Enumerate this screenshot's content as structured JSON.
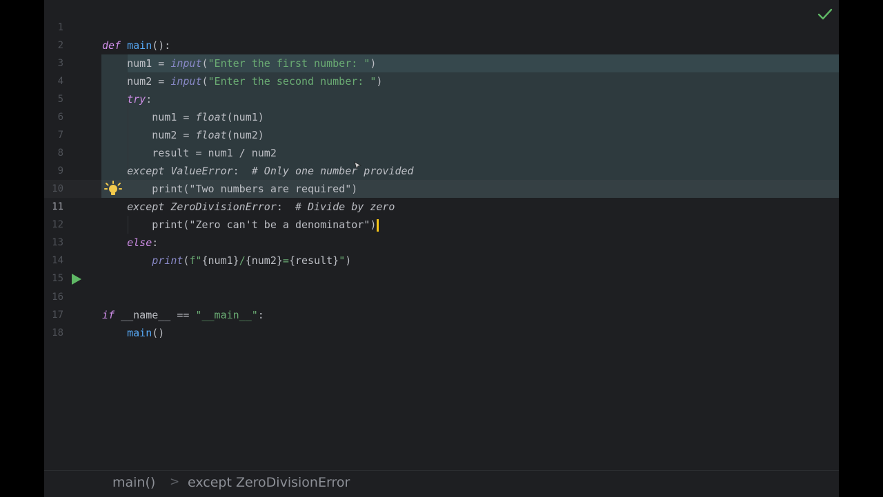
{
  "editor": {
    "language": "python",
    "current_line": 11,
    "lines": [
      {
        "n": "1",
        "text": "def main():"
      },
      {
        "n": "2",
        "text": "    num1 = input(\"Enter the first number: \")"
      },
      {
        "n": "3",
        "text": "    num2 = input(\"Enter the second number: \")"
      },
      {
        "n": "4",
        "text": "    try:"
      },
      {
        "n": "5",
        "text": "        num1 = float(num1)"
      },
      {
        "n": "6",
        "text": "        num2 = float(num2)"
      },
      {
        "n": "7",
        "text": "        result = num1 / num2"
      },
      {
        "n": "8",
        "text": "    except ValueError:  # Only one number provided"
      },
      {
        "n": "9",
        "text": "        print(\"Two numbers are required\")"
      },
      {
        "n": "10",
        "text": "    except ZeroDivisionError:  # Divide by zero"
      },
      {
        "n": "11",
        "text": "        print(\"Zero can't be a denominator\")"
      },
      {
        "n": "12",
        "text": "    else:"
      },
      {
        "n": "13",
        "text": "        print(f\"{num1}/{num2}={result}\")"
      },
      {
        "n": "14",
        "text": ""
      },
      {
        "n": "15",
        "text": ""
      },
      {
        "n": "16",
        "text": "if __name__ == \"__main__\":"
      },
      {
        "n": "17",
        "text": "    main()"
      },
      {
        "n": "18",
        "text": ""
      }
    ]
  },
  "gutter": {
    "bulb_icon": "lightbulb-icon",
    "run_icon": "run-icon"
  },
  "toolbar": {
    "inspection_icon": "checkmark-icon"
  },
  "breadcrumbs": {
    "items": [
      "main()",
      "except ZeroDivisionError"
    ],
    "separator": ">"
  },
  "colors": {
    "background": "#1e1f22",
    "selection": "#2e3a3e",
    "keyword": "#cf8ee8",
    "function": "#56a8f5",
    "string": "#6aab73",
    "comment": "#7a7e85",
    "caret": "#f5c518",
    "check": "#5fb865",
    "run": "#5fb865"
  }
}
